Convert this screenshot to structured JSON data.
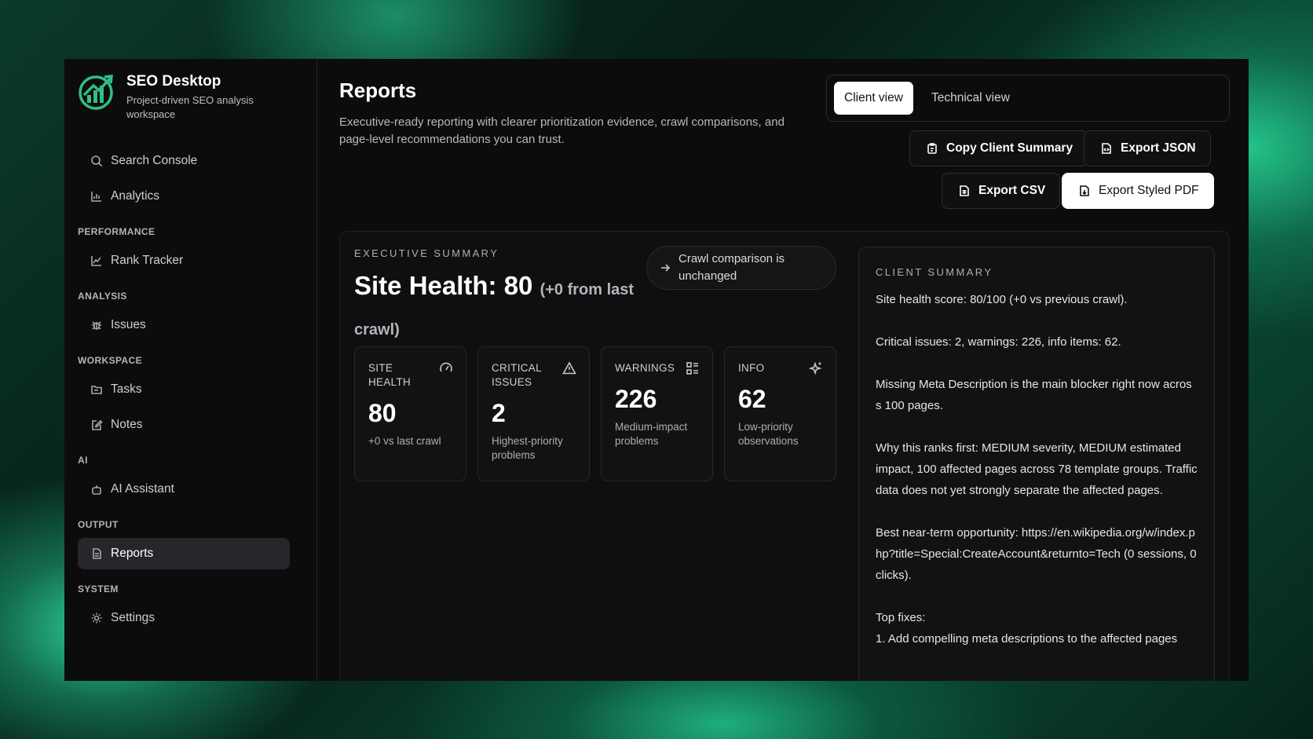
{
  "brand": {
    "title": "SEO Desktop",
    "subtitle": "Project-driven SEO analysis workspace"
  },
  "sidebar": {
    "top_items": [
      {
        "label": "Search Console",
        "icon": "search-icon"
      },
      {
        "label": "Analytics",
        "icon": "bar-chart-icon"
      }
    ],
    "sections": [
      {
        "title": "PERFORMANCE",
        "items": [
          {
            "label": "Rank Tracker",
            "icon": "line-chart-icon"
          }
        ]
      },
      {
        "title": "ANALYSIS",
        "items": [
          {
            "label": "Issues",
            "icon": "bug-icon"
          }
        ]
      },
      {
        "title": "WORKSPACE",
        "items": [
          {
            "label": "Tasks",
            "icon": "folder-icon"
          },
          {
            "label": "Notes",
            "icon": "edit-icon"
          }
        ]
      },
      {
        "title": "AI",
        "items": [
          {
            "label": "AI Assistant",
            "icon": "bot-icon"
          }
        ]
      },
      {
        "title": "OUTPUT",
        "items": [
          {
            "label": "Reports",
            "icon": "document-icon",
            "active": true
          }
        ]
      },
      {
        "title": "SYSTEM",
        "items": [
          {
            "label": "Settings",
            "icon": "gear-icon"
          }
        ]
      }
    ]
  },
  "header": {
    "title": "Reports",
    "description": "Executive-ready reporting with clearer prioritization evidence, crawl comparisons, and page-level recommendations you can trust."
  },
  "view_toggle": {
    "client": "Client view",
    "technical": "Technical view",
    "selected": "client"
  },
  "actions": {
    "copy_summary": "Copy Client Summary",
    "export_json": "Export JSON",
    "export_csv": "Export CSV",
    "export_pdf": "Export Styled PDF"
  },
  "executive": {
    "label": "EXECUTIVE SUMMARY",
    "headline": "Site Health: 80",
    "delta": "(+0 from last crawl)",
    "comparison": "Crawl comparison is unchanged"
  },
  "cards": [
    {
      "label": "SITE HEALTH",
      "value": "80",
      "note": "+0 vs last crawl",
      "icon": "gauge-icon"
    },
    {
      "label": "CRITICAL ISSUES",
      "value": "2",
      "note": "Highest-priority problems",
      "icon": "warning-icon"
    },
    {
      "label": "WARNINGS",
      "value": "226",
      "note": "Medium-impact problems",
      "icon": "list-icon"
    },
    {
      "label": "INFO",
      "value": "62",
      "note": "Low-priority observations",
      "icon": "sparkle-icon"
    }
  ],
  "client_summary": {
    "label": "CLIENT SUMMARY",
    "paragraphs": [
      "Site health score: 80/100 (+0 vs previous crawl).",
      "Critical issues: 2, warnings: 226, info items: 62.",
      "Missing Meta Description is the main blocker right now across 100 pages.",
      "Why this ranks first: MEDIUM severity, MEDIUM estimated impact, 100 affected pages across 78 template groups. Traffic data does not yet strongly separate the affected pages.",
      "Best near-term opportunity: https://en.wikipedia.org/w/index.php?title=Special:CreateAccount&returnto=Tech (0 sessions, 0 clicks).",
      "Top fixes:",
      "1. Add compelling meta descriptions to the affected pages"
    ]
  },
  "colors": {
    "background_green": "#1fae7c",
    "window_bg": "#0c0c0d",
    "active_nav_bg": "#26272a"
  }
}
